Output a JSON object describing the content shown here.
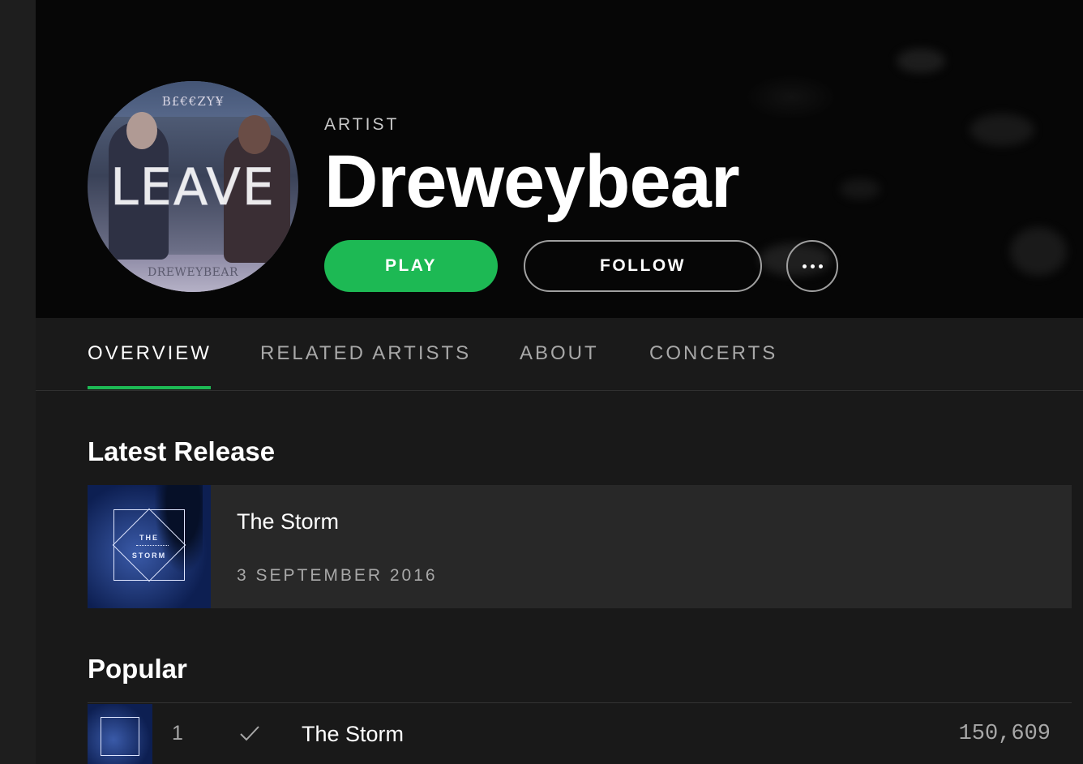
{
  "artist": {
    "type_label": "ARTIST",
    "name": "Dreweybear",
    "avatar": {
      "top_text": "B£€€ZY¥",
      "main_text": "LEAVE",
      "bottom_text": "DREWEYBEAR"
    }
  },
  "actions": {
    "play_label": "PLAY",
    "follow_label": "FOLLOW",
    "more_icon": "more-options-icon"
  },
  "tabs": [
    {
      "label": "OVERVIEW",
      "active": true
    },
    {
      "label": "RELATED ARTISTS",
      "active": false
    },
    {
      "label": "ABOUT",
      "active": false
    },
    {
      "label": "CONCERTS",
      "active": false
    }
  ],
  "latest_release": {
    "heading": "Latest Release",
    "title": "The Storm",
    "date": "3 SEPTEMBER 2016",
    "cover_text_1": "THE",
    "cover_text_2": "STORM"
  },
  "popular": {
    "heading": "Popular",
    "tracks": [
      {
        "number": "1",
        "title": "The Storm",
        "plays": "150,609",
        "saved_icon": "check-icon"
      }
    ]
  },
  "colors": {
    "accent": "#1db954",
    "background": "#191919",
    "header_background": "#060606",
    "card_background": "#282828",
    "muted_text": "#a8a8a8"
  }
}
